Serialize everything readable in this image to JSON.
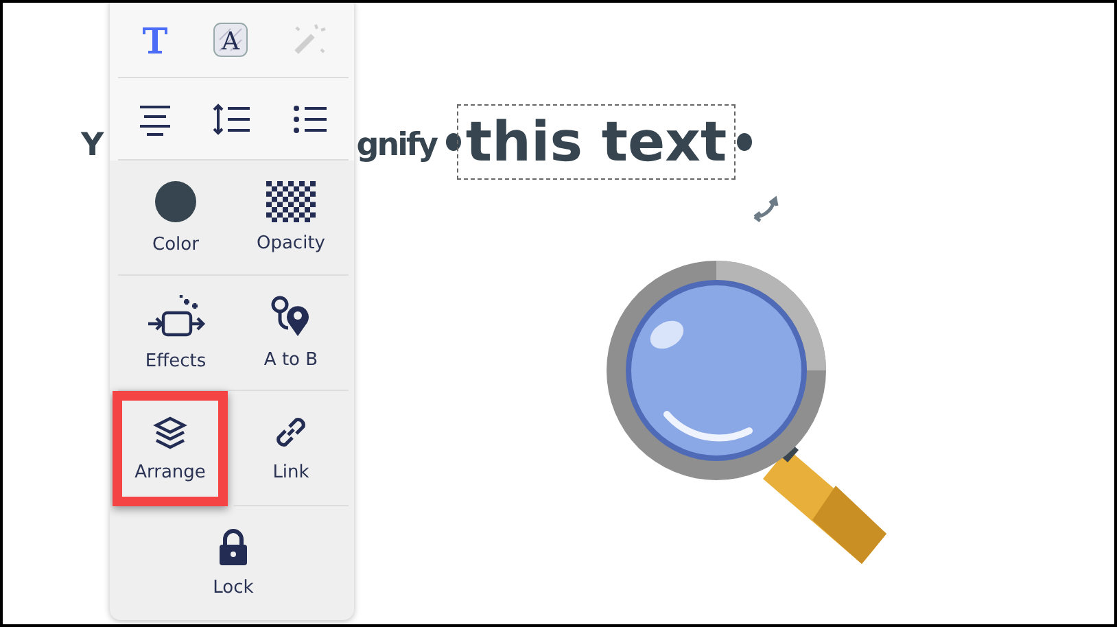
{
  "canvas": {
    "text_fragments": [
      "Y",
      "gnify"
    ],
    "selected_text": "this text"
  },
  "panel": {
    "top_tools": [
      {
        "kind": "text-style",
        "selected": true,
        "disabled": false
      },
      {
        "kind": "text-effect",
        "glyph": "A",
        "selected": false,
        "disabled": false
      },
      {
        "kind": "magic",
        "selected": false,
        "disabled": true
      }
    ],
    "format_tools": [
      {
        "kind": "align"
      },
      {
        "kind": "spacing"
      },
      {
        "kind": "list"
      }
    ],
    "actions": [
      {
        "kind": "color",
        "label": "Color",
        "highlighted": false
      },
      {
        "kind": "opacity",
        "label": "Opacity",
        "highlighted": false
      },
      {
        "kind": "effects",
        "label": "Effects",
        "highlighted": false
      },
      {
        "kind": "atob",
        "label": "A to B",
        "highlighted": false
      },
      {
        "kind": "arrange",
        "label": "Arrange",
        "highlighted": true
      },
      {
        "kind": "link",
        "label": "Link",
        "highlighted": false
      },
      {
        "kind": "lock",
        "label": "Lock",
        "highlighted": false
      }
    ]
  }
}
